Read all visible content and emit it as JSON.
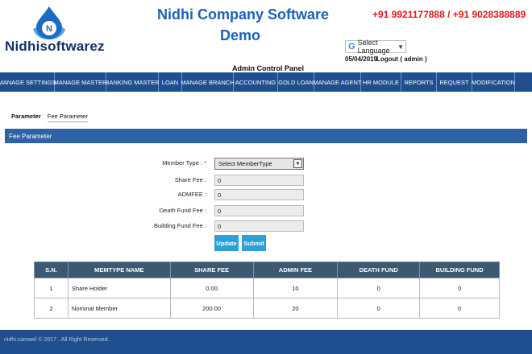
{
  "header": {
    "logo_text": "Nidhisoftwarez",
    "logo_letter": "N",
    "title_line1": "Nidhi Company Software",
    "title_line2": "Demo",
    "phone": "+91 9921177888 / +91 9028388889",
    "language_select": "Select Language",
    "date": "05/04/2019",
    "logout": "Logout ( admin )",
    "panel_title": "Admin Control Panel"
  },
  "nav": {
    "items": [
      {
        "label": "MANAGE SETTINGS"
      },
      {
        "label": "MANAGE MASTER"
      },
      {
        "label": "BANKING MASTER"
      },
      {
        "label": "LOAN"
      },
      {
        "label": "MANAGE BRANCH"
      },
      {
        "label": "ACCOUNTING"
      },
      {
        "label": "GOLD LOAN"
      },
      {
        "label": "MANAGE AGENT"
      },
      {
        "label": "HR MODULE"
      },
      {
        "label": "REPORTS"
      },
      {
        "label": "REQUEST"
      },
      {
        "label": "MODIFICATION"
      }
    ]
  },
  "breadcrumb": {
    "parent": "Parameter",
    "current": "Fee Parameter"
  },
  "section_title": "Fee Parameter",
  "form": {
    "member_type_label": "Member Type :",
    "member_type_required": "*",
    "member_type_value": "Select MemberType",
    "share_fee_label": "Share Fee :",
    "share_fee_value": "0",
    "admfee_label": "ADMFEE :",
    "admfee_value": "0",
    "death_fund_label": "Death Fund Fee :",
    "death_fund_value": "0",
    "building_fund_label": "Building Fund Fee :",
    "building_fund_value": "0",
    "update_label": "Update",
    "submit_label": "Submit"
  },
  "table": {
    "headers": [
      "S.N.",
      "MEMTYPE NAME",
      "SHARE FEE",
      "ADMIN FEE",
      "DEATH FUND",
      "BUILDING FUND"
    ],
    "rows": [
      [
        "1",
        "Share Holder",
        "0.00",
        "10",
        "0",
        "0"
      ],
      [
        "2",
        "Nominal Member",
        "200.00",
        "20",
        "0",
        "0"
      ]
    ]
  },
  "footer": {
    "text": "nidhi.camwel © 2017 . All Right Reserved."
  },
  "colors": {
    "nav_bg": "#1f4f8f",
    "section_bg": "#2d63a6",
    "button_bg": "#2aa1d8",
    "table_header_bg": "#3c5873",
    "title_blue": "#1a63b8",
    "phone_red": "#e4171b"
  }
}
